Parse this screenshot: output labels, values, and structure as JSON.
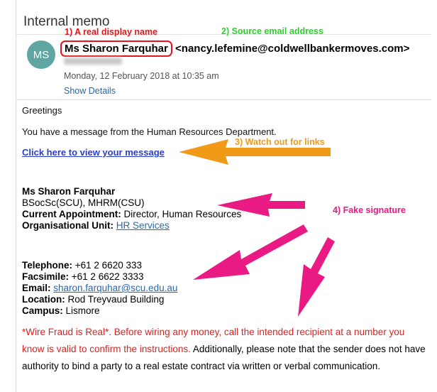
{
  "email": {
    "subject": "Internal memo",
    "avatar_initials": "MS",
    "from_name": "Ms Sharon Farquhar",
    "from_email": "<nancy.lefemine@coldwellbankermoves.com>",
    "date": "Monday, 12 February 2018 at 10:35 am",
    "show_details": "Show Details",
    "greeting": "Greetings",
    "message": "You have a message from the Human Resources Department.",
    "link_text": "Click here to view your message"
  },
  "signature": {
    "name": "Ms Sharon Farquhar",
    "qualifications": "BSocSc(SCU), MHRM(CSU)",
    "appointment_label": "Current Appointment:",
    "appointment_value": " Director, Human Resources",
    "unit_label": "Organisational Unit:",
    "unit_value": "HR Services",
    "telephone_label": "Telephone:",
    "telephone_value": " +61 2 6620 333",
    "facsimile_label": "Facsimile:",
    "facsimile_value": " +61 2 6622 3333",
    "email_label": "Email:",
    "email_value": "sharon.farquhar@scu.edu.au",
    "location_label": "Location:",
    "location_value": " Rod Treyvaud Building",
    "campus_label": "Campus:",
    "campus_value": " Lismore"
  },
  "disclaimer": {
    "red": "*Wire Fraud is Real*.  Before wiring any money, call the intended recipient at a number you know is valid to confirm the instructions.",
    "black": " Additionally, please note that the sender does not have authority to bind a party to a real estate contract via written or verbal communication."
  },
  "annotations": {
    "a1": "1) A real display name",
    "a2": "2) Source email address",
    "a3": "3) Watch out for links",
    "a4": "4) Fake signature"
  },
  "colors": {
    "annotation_1": "#e0181c",
    "annotation_2": "#2bd12a",
    "annotation_3": "#f19a17",
    "annotation_4": "#ea1a85",
    "link": "#2b3dc7",
    "avatar": "#5fa6a2"
  }
}
